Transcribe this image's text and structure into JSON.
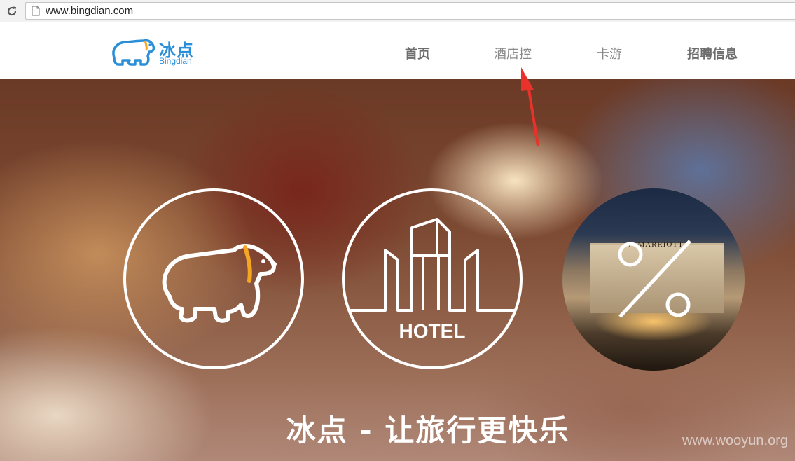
{
  "browser": {
    "url": "www.bingdian.com",
    "reload_icon": "reload-icon",
    "page_icon": "page-icon"
  },
  "header": {
    "logo": {
      "cn": "冰点",
      "en": "Bingdian",
      "icon": "polar-bear-logo-icon"
    },
    "nav": [
      {
        "label": "首页"
      },
      {
        "label": "酒店控"
      },
      {
        "label": "卡游"
      },
      {
        "label": "招聘信息"
      }
    ]
  },
  "hero": {
    "panels": [
      {
        "icon": "polar-bear-icon"
      },
      {
        "icon": "hotel-building-icon",
        "label": "HOTEL"
      },
      {
        "icon": "percent-icon",
        "brand": "JW MARRIOTT"
      }
    ],
    "tagline": "冰点 - 让旅行更快乐",
    "watermark": "www.wooyun.org"
  },
  "colors": {
    "brand_blue": "#2a8fd8",
    "accent_orange": "#f5a623",
    "annotation_red": "#e8322b"
  }
}
